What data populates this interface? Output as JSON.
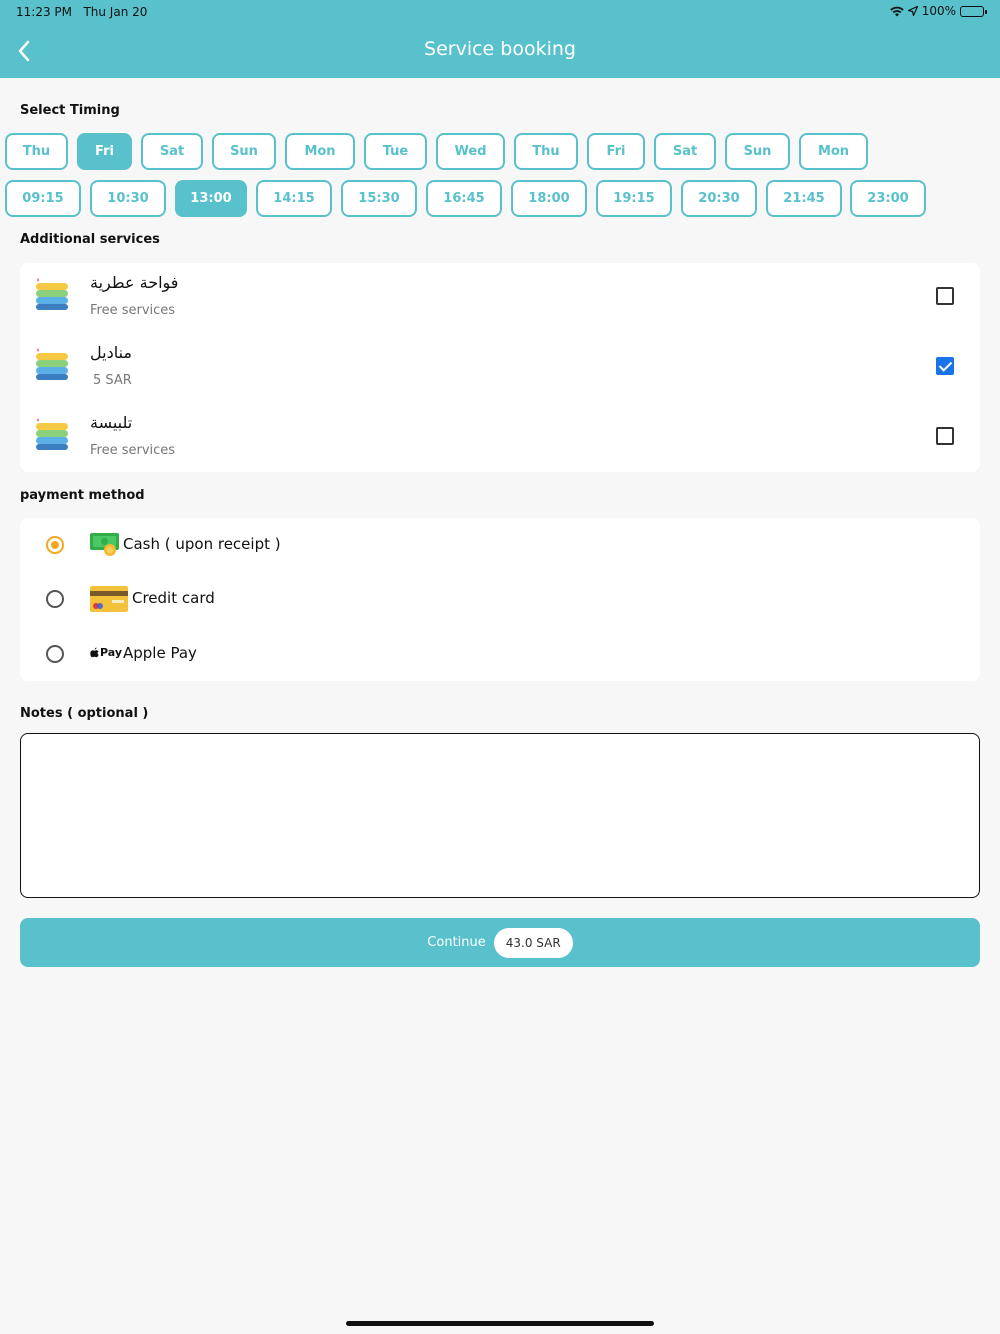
{
  "status": {
    "time": "11:23 PM",
    "date": "Thu Jan 20",
    "battery": "100%"
  },
  "header": {
    "title": "Service booking"
  },
  "timing": {
    "label": "Select Timing",
    "days": [
      "Thu",
      "Fri",
      "Sat",
      "Sun",
      "Mon",
      "Tue",
      "Wed",
      "Thu",
      "Fri",
      "Sat",
      "Sun",
      "Mon"
    ],
    "selected_day": "Fri",
    "times": [
      "09:15",
      "10:30",
      "13:00",
      "14:15",
      "15:30",
      "16:45",
      "18:00",
      "19:15",
      "20:30",
      "21:45",
      "23:00"
    ],
    "selected_time": "13:00"
  },
  "additional": {
    "label": "Additional services",
    "items": [
      {
        "name": "فواحة عطرية",
        "price": "Free services",
        "checked": false
      },
      {
        "name": "مناديل",
        "price": "5 SAR",
        "checked": true
      },
      {
        "name": "تلبيسة",
        "price": "Free services",
        "checked": false
      }
    ]
  },
  "payment": {
    "label": "payment method",
    "options": [
      {
        "label": "Cash ( upon receipt )",
        "icon": "cash-icon",
        "selected": true
      },
      {
        "label": "Credit card",
        "icon": "credit-card-icon",
        "selected": false
      },
      {
        "label": "Apple Pay",
        "icon": "apple-pay-icon",
        "icon_text": "Pay",
        "selected": false
      }
    ]
  },
  "notes": {
    "label": "Notes ( optional )",
    "value": ""
  },
  "footer": {
    "continue_label": "Continue",
    "total": "43.0 SAR"
  },
  "colors": {
    "accent": "#58c1cc",
    "radio_selected": "#f5a623",
    "checkbox_checked": "#1a73e8"
  }
}
